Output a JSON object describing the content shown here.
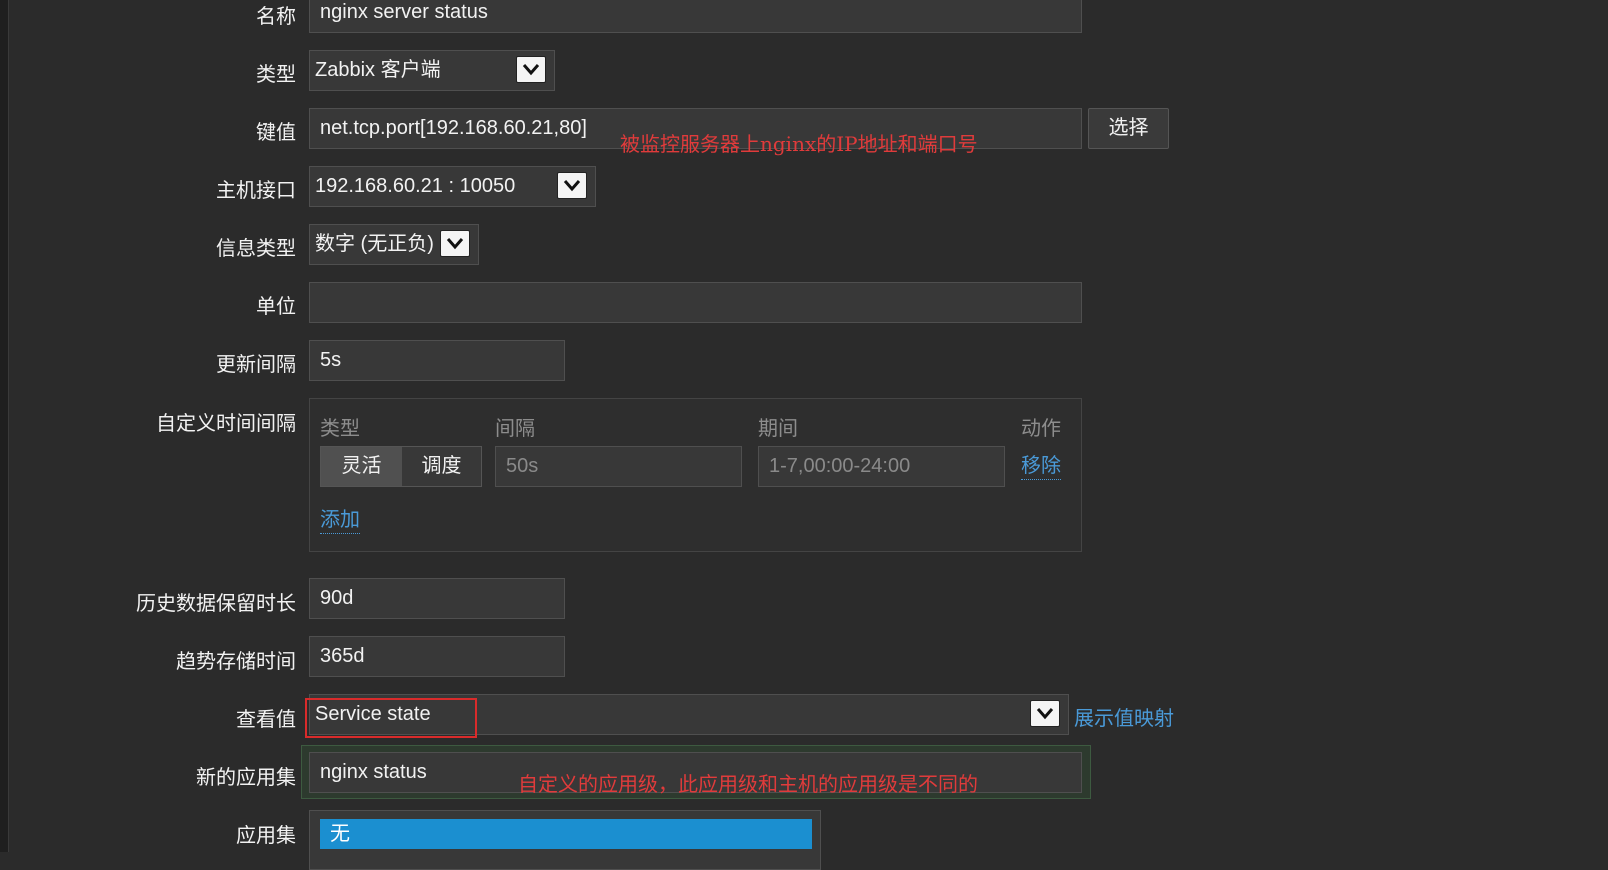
{
  "form": {
    "name": {
      "label": "名称",
      "value": "nginx server status"
    },
    "type": {
      "label": "类型",
      "value": "Zabbix 客户端"
    },
    "key": {
      "label": "键值",
      "value": "net.tcp.port[192.168.60.21,80]",
      "select_button": "选择"
    },
    "host_interface": {
      "label": "主机接口",
      "value": "192.168.60.21 : 10050"
    },
    "info_type": {
      "label": "信息类型",
      "value": "数字 (无正负)"
    },
    "units": {
      "label": "单位",
      "value": ""
    },
    "update_interval": {
      "label": "更新间隔",
      "value": "5s"
    },
    "custom_intervals": {
      "label": "自定义时间间隔",
      "columns": {
        "type": "类型",
        "interval": "间隔",
        "period": "期间",
        "action": "动作"
      },
      "row": {
        "type_options": [
          "灵活",
          "调度"
        ],
        "selected_type": "灵活",
        "interval_placeholder": "50s",
        "period_placeholder": "1-7,00:00-24:00",
        "remove": "移除"
      },
      "add": "添加"
    },
    "history": {
      "label": "历史数据保留时长",
      "value": "90d"
    },
    "trends": {
      "label": "趋势存储时间",
      "value": "365d"
    },
    "value_map": {
      "label": "查看值",
      "value": "Service state",
      "link": "展示值映射"
    },
    "new_application": {
      "label": "新的应用集",
      "value": "nginx status"
    },
    "applications": {
      "label": "应用集",
      "selected": "无"
    }
  },
  "annotations": {
    "key_note": "被监控服务器上nginx的IP地址和端口号",
    "app_note": "自定义的应用级，此应用级和主机的应用级是不同的"
  },
  "colors": {
    "background": "#2b2b2b",
    "field": "#383838",
    "link": "#4a9ad8",
    "annotation": "#e03b3b",
    "highlight_box": "#d92b2b",
    "selected_option": "#1b8fd0"
  }
}
